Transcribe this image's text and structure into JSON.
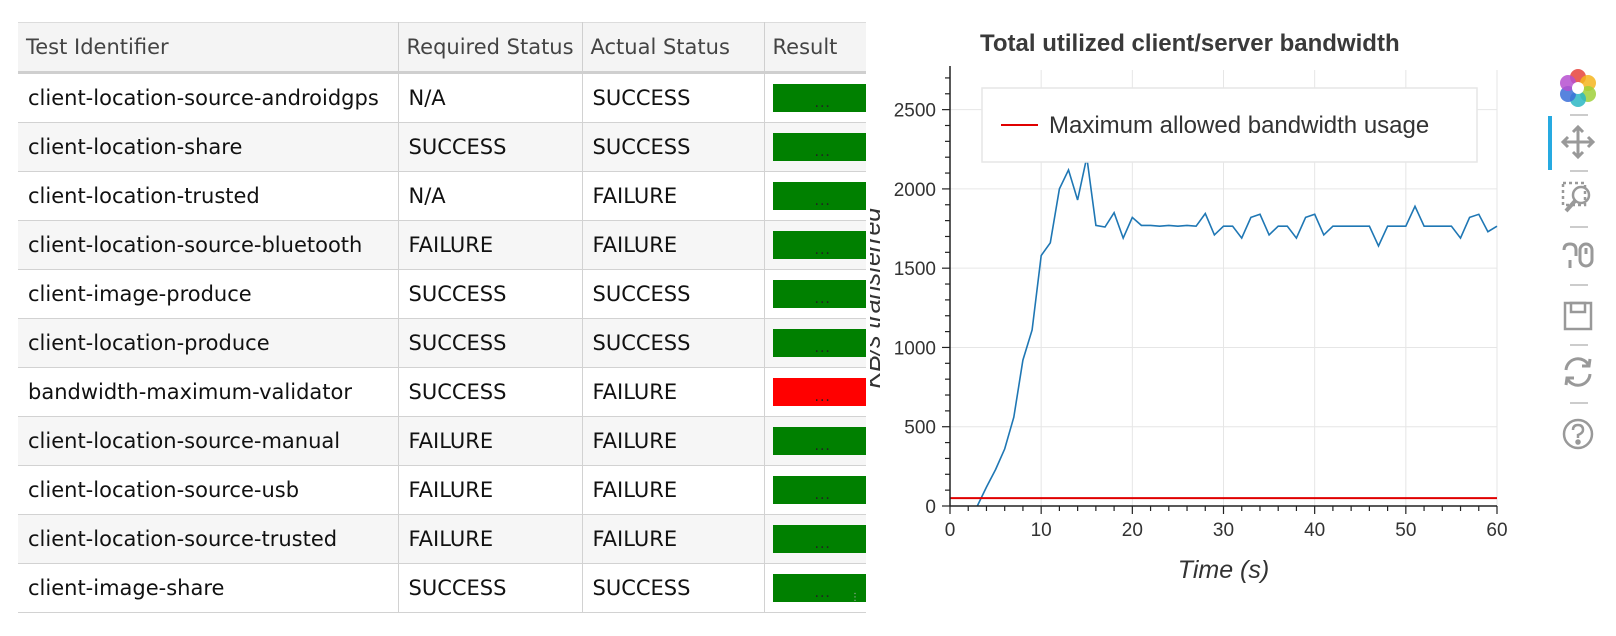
{
  "table": {
    "columns": [
      "Test Identifier",
      "Required Status",
      "Actual Status",
      "Result"
    ],
    "rows": [
      {
        "id": "client-location-source-androidgps",
        "required": "N/A",
        "actual": "SUCCESS",
        "result": "pass",
        "result_label": "..."
      },
      {
        "id": "client-location-share",
        "required": "SUCCESS",
        "actual": "SUCCESS",
        "result": "pass",
        "result_label": "..."
      },
      {
        "id": "client-location-trusted",
        "required": "N/A",
        "actual": "FAILURE",
        "result": "pass",
        "result_label": "..."
      },
      {
        "id": "client-location-source-bluetooth",
        "required": "FAILURE",
        "actual": "FAILURE",
        "result": "pass",
        "result_label": "..."
      },
      {
        "id": "client-image-produce",
        "required": "SUCCESS",
        "actual": "SUCCESS",
        "result": "pass",
        "result_label": "..."
      },
      {
        "id": "client-location-produce",
        "required": "SUCCESS",
        "actual": "SUCCESS",
        "result": "pass",
        "result_label": "..."
      },
      {
        "id": "bandwidth-maximum-validator",
        "required": "SUCCESS",
        "actual": "FAILURE",
        "result": "fail",
        "result_label": "..."
      },
      {
        "id": "client-location-source-manual",
        "required": "FAILURE",
        "actual": "FAILURE",
        "result": "pass",
        "result_label": "..."
      },
      {
        "id": "client-location-source-usb",
        "required": "FAILURE",
        "actual": "FAILURE",
        "result": "pass",
        "result_label": "..."
      },
      {
        "id": "client-location-source-trusted",
        "required": "FAILURE",
        "actual": "FAILURE",
        "result": "pass",
        "result_label": "..."
      },
      {
        "id": "client-image-share",
        "required": "SUCCESS",
        "actual": "SUCCESS",
        "result": "pass",
        "result_label": "..."
      }
    ],
    "colors": {
      "pass": "#008000",
      "fail": "#ff0000"
    }
  },
  "chart_data": {
    "type": "line",
    "title": "Total utilized client/server bandwidth",
    "xlabel": "Time (s)",
    "ylabel": "KB/s transferred",
    "xlim": [
      0,
      60
    ],
    "ylim": [
      0,
      2750
    ],
    "x_ticks": [
      0,
      10,
      20,
      30,
      40,
      50,
      60
    ],
    "y_ticks": [
      0,
      500,
      1000,
      1500,
      2000,
      2500
    ],
    "grid": true,
    "legend_position": "top-right",
    "series": [
      {
        "name": "",
        "color": "#1f77b4",
        "x": [
          3,
          4,
          5,
          6,
          7,
          8,
          9,
          10,
          11,
          12,
          13,
          14,
          15,
          16,
          17,
          18,
          19,
          20,
          21,
          22,
          23,
          24,
          25,
          26,
          27,
          28,
          29,
          30,
          31,
          32,
          33,
          34,
          35,
          36,
          37,
          38,
          39,
          40,
          41,
          42,
          43,
          44,
          45,
          46,
          47,
          48,
          49,
          50,
          51,
          52,
          53,
          54,
          55,
          56,
          57,
          58,
          59,
          60
        ],
        "y": [
          0,
          120,
          230,
          360,
          560,
          920,
          1110,
          1580,
          1660,
          2000,
          2120,
          1930,
          2200,
          1770,
          1760,
          1850,
          1690,
          1820,
          1770,
          1770,
          1765,
          1770,
          1765,
          1770,
          1765,
          1845,
          1710,
          1765,
          1765,
          1690,
          1820,
          1840,
          1710,
          1765,
          1765,
          1690,
          1820,
          1840,
          1710,
          1765,
          1765,
          1765,
          1765,
          1765,
          1640,
          1765,
          1765,
          1765,
          1890,
          1765,
          1765,
          1765,
          1765,
          1690,
          1820,
          1840,
          1730,
          1765
        ]
      },
      {
        "name": "Maximum allowed bandwidth usage",
        "color": "#e00000",
        "x": [
          0,
          60
        ],
        "y": [
          50,
          50
        ]
      }
    ]
  },
  "toolbar": {
    "tools": [
      "bokeh-logo-icon",
      "pan-icon",
      "box-zoom-icon",
      "wheel-zoom-icon",
      "save-icon",
      "reset-icon",
      "help-icon"
    ],
    "active_color": "#26aae1"
  }
}
